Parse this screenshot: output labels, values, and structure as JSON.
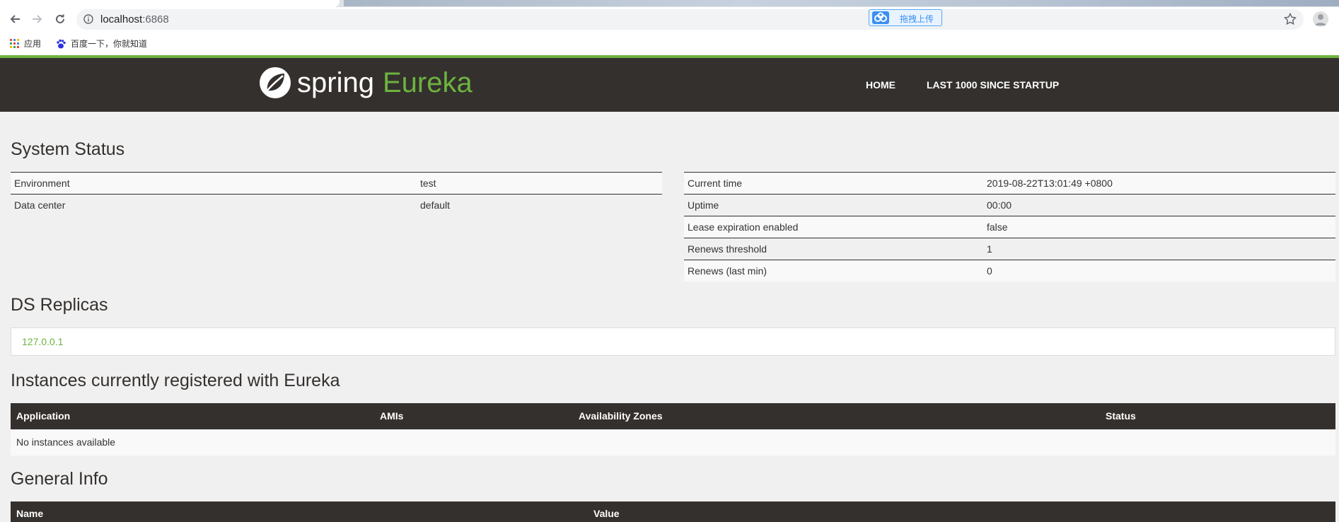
{
  "browser": {
    "url_host": "localhost",
    "url_port": ":6868",
    "upload_badge": "拖拽上传",
    "bookmarks": [
      {
        "label": "应用",
        "icon": "apps-grid-icon"
      },
      {
        "label": "百度一下，你就知道",
        "icon": "baidu-paw-icon"
      }
    ]
  },
  "header": {
    "brand_spring": "spring",
    "brand_eureka": "Eureka",
    "nav": [
      "HOME",
      "LAST 1000 SINCE STARTUP"
    ]
  },
  "system_status": {
    "title": "System Status",
    "left": [
      {
        "key": "Environment",
        "value": "test"
      },
      {
        "key": "Data center",
        "value": "default"
      }
    ],
    "right": [
      {
        "key": "Current time",
        "value": "2019-08-22T13:01:49 +0800"
      },
      {
        "key": "Uptime",
        "value": "00:00"
      },
      {
        "key": "Lease expiration enabled",
        "value": "false"
      },
      {
        "key": "Renews threshold",
        "value": "1"
      },
      {
        "key": "Renews (last min)",
        "value": "0"
      }
    ]
  },
  "replicas": {
    "title": "DS Replicas",
    "items": [
      "127.0.0.1"
    ]
  },
  "instances": {
    "title": "Instances currently registered with Eureka",
    "columns": [
      "Application",
      "AMIs",
      "Availability Zones",
      "Status"
    ],
    "empty_text": "No instances available"
  },
  "general_info": {
    "title": "General Info",
    "columns": [
      "Name",
      "Value"
    ]
  },
  "colors": {
    "accent": "#6db33f",
    "header_bg": "#34302d",
    "page_bg": "#f0f0f0"
  }
}
